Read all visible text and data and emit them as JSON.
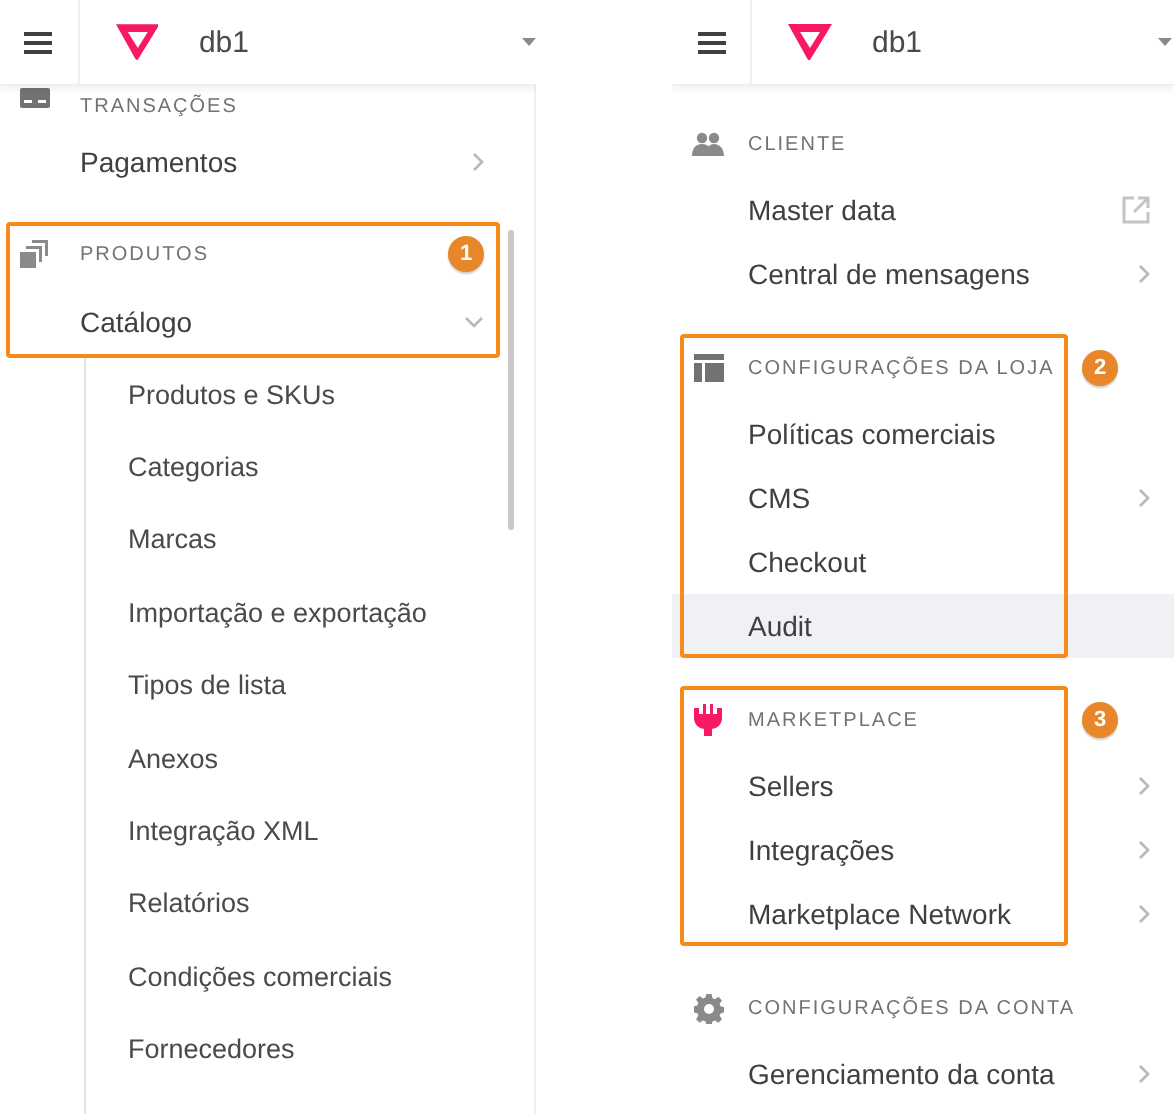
{
  "panels": [
    {
      "header": {
        "account": "db1"
      },
      "sections": [
        {
          "heading": "TRANSAÇÕES",
          "items": [
            {
              "label": "Pagamentos",
              "kind": "submenu",
              "expanded": false,
              "selected": false
            }
          ]
        },
        {
          "heading": "PRODUTOS",
          "callout": "1",
          "items": [
            {
              "label": "Catálogo",
              "kind": "submenu",
              "expanded": true,
              "selected": false,
              "children": [
                {
                  "label": "Produtos e SKUs",
                  "selected": false
                },
                {
                  "label": "Categorias",
                  "selected": false
                },
                {
                  "label": "Marcas",
                  "selected": false
                },
                {
                  "label": "Importação e exportação",
                  "selected": false
                },
                {
                  "label": "Tipos de lista",
                  "selected": false
                },
                {
                  "label": "Anexos",
                  "selected": false
                },
                {
                  "label": "Integração XML",
                  "selected": false
                },
                {
                  "label": "Relatórios",
                  "selected": false
                },
                {
                  "label": "Condições comerciais",
                  "selected": false
                },
                {
                  "label": "Fornecedores",
                  "selected": false
                }
              ]
            }
          ]
        }
      ]
    },
    {
      "header": {
        "account": "db1"
      },
      "sections": [
        {
          "heading": "CLIENTE",
          "items": [
            {
              "label": "Master data",
              "kind": "external",
              "selected": false
            },
            {
              "label": "Central de mensagens",
              "kind": "submenu",
              "expanded": false,
              "selected": false
            }
          ]
        },
        {
          "heading": "CONFIGURAÇÕES DA LOJA",
          "callout": "2",
          "items": [
            {
              "label": "Políticas comerciais",
              "kind": "page",
              "selected": false
            },
            {
              "label": "CMS",
              "kind": "submenu",
              "expanded": false,
              "selected": false
            },
            {
              "label": "Checkout",
              "kind": "page",
              "selected": false
            },
            {
              "label": "Audit",
              "kind": "page",
              "selected": true
            }
          ]
        },
        {
          "heading": "MARKETPLACE",
          "callout": "3",
          "items": [
            {
              "label": "Sellers",
              "kind": "submenu",
              "expanded": false,
              "selected": false
            },
            {
              "label": "Integrações",
              "kind": "submenu",
              "expanded": false,
              "selected": false
            },
            {
              "label": "Marketplace Network",
              "kind": "submenu",
              "expanded": false,
              "selected": false
            }
          ]
        },
        {
          "heading": "CONFIGURAÇÕES DA CONTA",
          "items": [
            {
              "label": "Gerenciamento da conta",
              "kind": "submenu",
              "expanded": false,
              "selected": false
            }
          ]
        }
      ]
    }
  ]
}
